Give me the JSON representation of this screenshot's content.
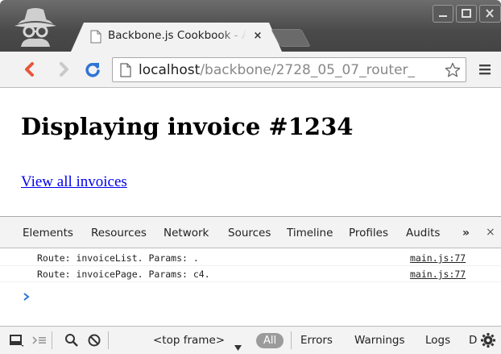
{
  "browser": {
    "tab": {
      "title": "Backbone.js Cookbook - A",
      "close_glyph": "×"
    },
    "address": {
      "host": "localhost",
      "path": "/backbone/2728_05_07_router_"
    },
    "icons": [
      "incognito-icon",
      "page-icon",
      "back-icon",
      "forward-icon",
      "reload-icon",
      "star-icon",
      "menu-icon"
    ],
    "colors": {
      "back_arrow": "#e8553d",
      "reload": "#2e74d6",
      "link": "#0000ee"
    }
  },
  "page": {
    "heading": "Displaying invoice #1234",
    "link": "View all invoices"
  },
  "devtools": {
    "tabs": [
      "Elements",
      "Resources",
      "Network",
      "Sources",
      "Timeline",
      "Profiles",
      "Audits"
    ],
    "more_glyph": "»",
    "close_glyph": "×",
    "console": [
      {
        "message": "Route: invoiceList. Params: .",
        "source": "main.js:77"
      },
      {
        "message": "Route: invoicePage. Params: c4.",
        "source": "main.js:77"
      }
    ],
    "bottom": {
      "frame": "<top frame>",
      "filters": {
        "all": "All",
        "errors": "Errors",
        "warnings": "Warnings",
        "logs": "Logs",
        "debug": "D"
      }
    }
  }
}
